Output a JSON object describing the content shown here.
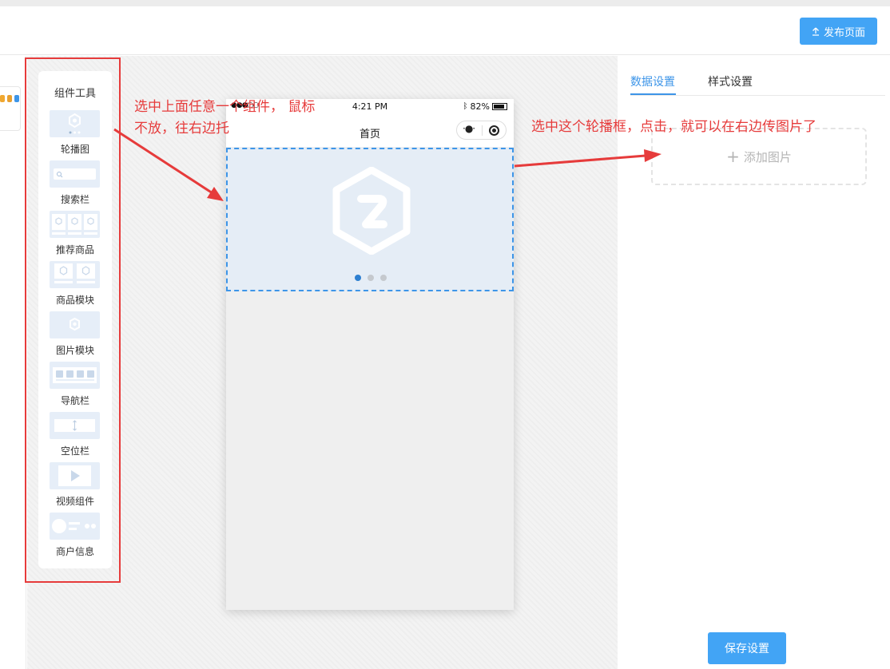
{
  "header": {
    "publish_label": "发布页面"
  },
  "toolbox": {
    "title": "组件工具",
    "items": [
      {
        "label": "轮播图",
        "icon": "carousel-icon"
      },
      {
        "label": "搜索栏",
        "icon": "search-bar-icon"
      },
      {
        "label": "推荐商品",
        "icon": "recommended-products-icon"
      },
      {
        "label": "商品模块",
        "icon": "product-module-icon"
      },
      {
        "label": "图片模块",
        "icon": "image-module-icon"
      },
      {
        "label": "导航栏",
        "icon": "nav-bar-icon"
      },
      {
        "label": "空位栏",
        "icon": "spacer-icon"
      },
      {
        "label": "视频组件",
        "icon": "video-icon"
      },
      {
        "label": "商户信息",
        "icon": "merchant-info-icon"
      }
    ]
  },
  "phone": {
    "status_time": "4:21 PM",
    "battery": "82%",
    "signal": "●●●○○",
    "nav_title": "首页",
    "carousel_page_count": 3,
    "carousel_active_index": 0
  },
  "settings": {
    "tabs": [
      {
        "label": "数据设置",
        "active": true
      },
      {
        "label": "样式设置",
        "active": false
      }
    ],
    "add_image_label": "添加图片",
    "save_label": "保存设置"
  },
  "annotations": {
    "drag_note_line1": "选中上面任意一个组件， 鼠标",
    "drag_note_line2": "不放，往右边托",
    "upload_note": "选中这个轮播框，点击，就可以在右边传图片了"
  },
  "colors": {
    "accent": "#42a4f5",
    "annotation_red": "#e63b3b",
    "tab_active": "#3d95e8",
    "carousel_dot_active": "#2d7fd0"
  }
}
